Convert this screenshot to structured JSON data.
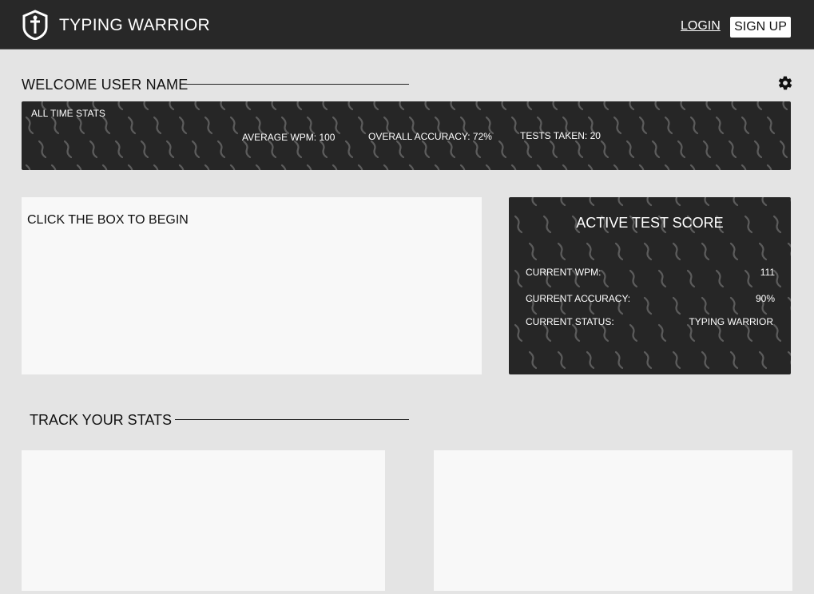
{
  "header": {
    "brand": "TYPING WARRIOR",
    "login_label": "LOGIN",
    "signup_label": "SIGN UP"
  },
  "welcome": {
    "title": "WELCOME USER NAME"
  },
  "all_time_stats": {
    "title": "ALL TIME STATS",
    "average_wpm": "AVERAGE WPM: 100",
    "overall_accuracy": "OVERALL ACCURACY: 72%",
    "tests_taken": "TESTS TAKEN: 20"
  },
  "typing_box": {
    "prompt": "CLICK THE BOX TO BEGIN"
  },
  "active_score": {
    "title": "ACTIVE TEST SCORE",
    "rows": [
      {
        "label": "CURRENT WPM:",
        "value": "111"
      },
      {
        "label": "CURRENT ACCURACY:",
        "value": "90%"
      },
      {
        "label": "CURRENT STATUS:",
        "value": "TYPING WARRIOR"
      }
    ]
  },
  "track": {
    "title": "TRACK YOUR STATS"
  },
  "colors": {
    "header_bg": "#282828",
    "page_bg": "#e4e4e4",
    "panel_dark": "#262626",
    "card_light": "#f8f8f8",
    "pattern": "#5c5c5c"
  },
  "icons": {
    "logo": "shield-sword-icon",
    "settings": "gear-icon"
  }
}
